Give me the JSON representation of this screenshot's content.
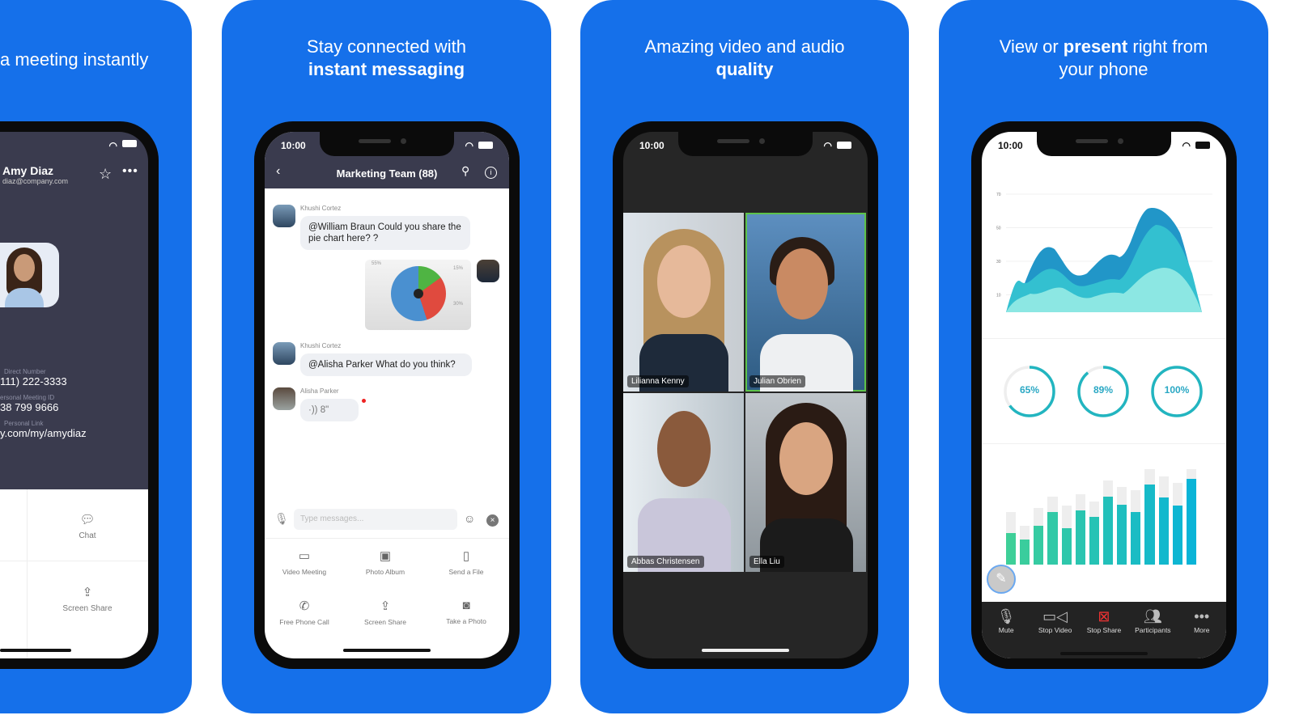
{
  "panels": [
    {
      "caption": "a meeting instantly",
      "contact": {
        "name": "Amy Diaz",
        "email": "diaz@company.com",
        "fields": [
          {
            "label": "Direct Number",
            "value": "111) 222-3333"
          },
          {
            "label": "ersonal Meeting ID",
            "value": "38 799 9666"
          },
          {
            "label": "Personal Link",
            "value": "y.com/my/amydiaz"
          }
        ],
        "actions": [
          "Chat",
          "Screen Share"
        ]
      }
    },
    {
      "caption_line1": "Stay connected with",
      "caption_bold": "instant messaging",
      "time": "10:00",
      "chat_title": "Marketing Team (88)",
      "messages": [
        {
          "sender": "Khushi Cortez",
          "text": "@William Braun Could you share the pie chart here? ?"
        },
        {
          "sender": "",
          "attachment": "pie chart image",
          "pie_labels": [
            "55%",
            "15%",
            "30%"
          ]
        },
        {
          "sender": "Khushi Cortez",
          "text": "@Alisha Parker What do you think?"
        },
        {
          "sender": "Alisha Parker",
          "voice": "8\""
        }
      ],
      "input_placeholder": "Type messages...",
      "actions": [
        "Video Meeting",
        "Photo Album",
        "Send a File",
        "Free Phone Call",
        "Screen Share",
        "Take a Photo"
      ]
    },
    {
      "caption_line1": "Amazing video and audio",
      "caption_bold": "quality",
      "time": "10:00",
      "participants": [
        "Lilianna Kenny",
        "Julian Obrien",
        "Abbas Christensen",
        "Ella Liu"
      ]
    },
    {
      "caption_pre": "View or ",
      "caption_bold": "present",
      "caption_post": " right from",
      "caption_line2": "your phone",
      "time": "10:00",
      "area_ticks": [
        "70",
        "50",
        "30",
        "10"
      ],
      "rings": [
        {
          "label": "65%",
          "value": 65
        },
        {
          "label": "89%",
          "value": 89
        },
        {
          "label": "100%",
          "value": 100
        }
      ],
      "bars": [
        {
          "value": 0.33,
          "total": 0.55
        },
        {
          "value": 0.26,
          "total": 0.41
        },
        {
          "value": 0.41,
          "total": 0.59
        },
        {
          "value": 0.55,
          "total": 0.71
        },
        {
          "value": 0.38,
          "total": 0.62
        },
        {
          "value": 0.57,
          "total": 0.74
        },
        {
          "value": 0.5,
          "total": 0.66
        },
        {
          "value": 0.71,
          "total": 0.88
        },
        {
          "value": 0.63,
          "total": 0.81
        },
        {
          "value": 0.55,
          "total": 0.78
        },
        {
          "value": 0.84,
          "total": 1.0
        },
        {
          "value": 0.7,
          "total": 0.92
        },
        {
          "value": 0.62,
          "total": 0.86
        },
        {
          "value": 0.9,
          "total": 1.0
        }
      ],
      "toolbar": [
        "Mute",
        "Stop Video",
        "Stop Share",
        "Participants",
        "More"
      ]
    }
  ],
  "colors": {
    "brand_blue": "#1570ea",
    "teal": "#1fb5c9",
    "green": "#3ecf98"
  }
}
